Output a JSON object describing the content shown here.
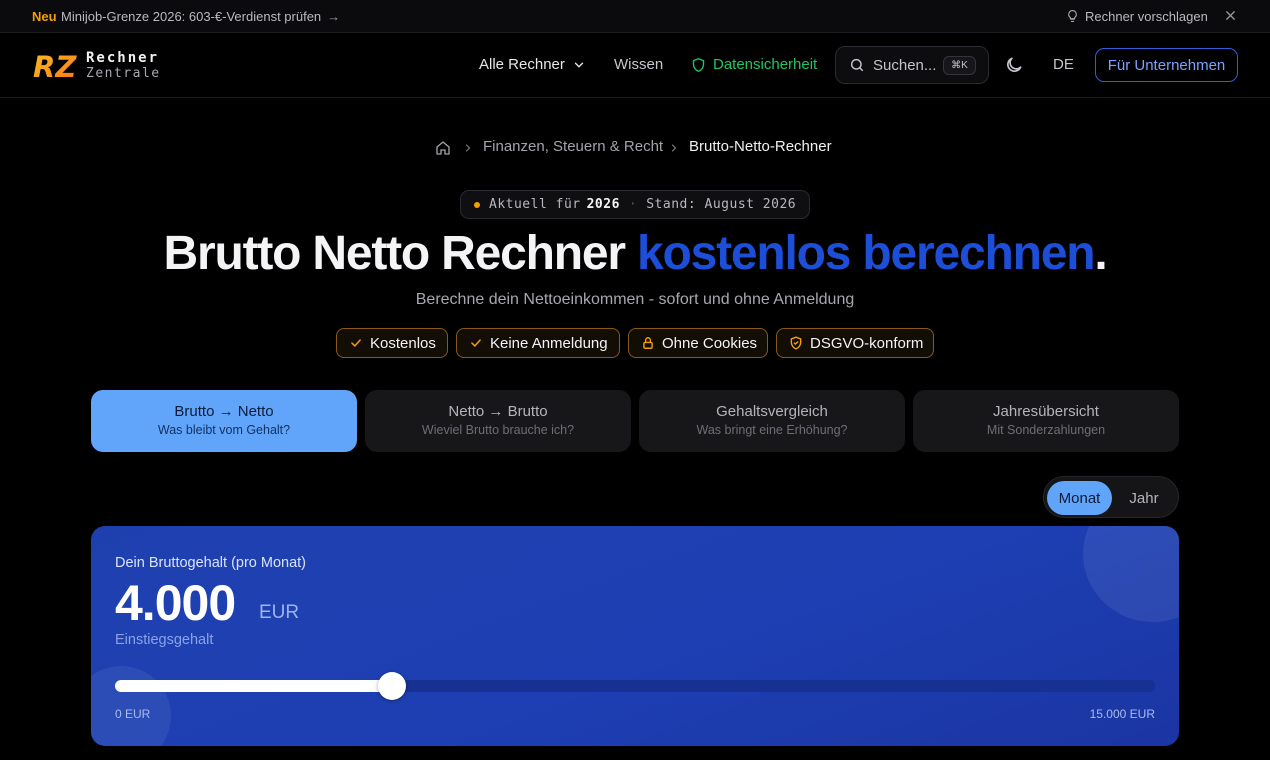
{
  "announcement": {
    "tag": "Neu",
    "message": "Minijob-Grenze 2026: 603-€-Verdienst prüfen",
    "arrow": "→",
    "suggest_label": "Rechner vorschlagen"
  },
  "header": {
    "logo_mark": "RZ",
    "logo_line1": "Rechner",
    "logo_line2": "Zentrale",
    "nav_all": "Alle Rechner",
    "nav_wissen": "Wissen",
    "nav_security": "Datensicherheit",
    "search_placeholder": "Suchen...",
    "search_shortcut": "⌘K",
    "language": "DE",
    "business_button": "Für Unternehmen"
  },
  "breadcrumb": {
    "category": "Finanzen, Steuern & Recht",
    "current": "Brutto-Netto-Rechner",
    "separator": "›"
  },
  "badge": {
    "prefix": "Aktuell für",
    "year": "2026",
    "divider": "·",
    "stand": "Stand: August 2026"
  },
  "hero": {
    "title_main": "Brutto Netto Rechner",
    "title_accent": "kostenlos berechnen",
    "title_end": ".",
    "subtitle": "Berechne dein Nettoeinkommen - sofort und ohne Anmeldung"
  },
  "features": [
    {
      "label": "Kostenlos",
      "icon": "check-icon"
    },
    {
      "label": "Keine Anmeldung",
      "icon": "check-icon"
    },
    {
      "label": "Ohne Cookies",
      "icon": "lock-icon"
    },
    {
      "label": "DSGVO-konform",
      "icon": "shield-icon"
    }
  ],
  "tabs": [
    {
      "title": "Brutto → Netto",
      "subtitle": "Was bleibt vom Gehalt?",
      "active": true
    },
    {
      "title": "Netto → Brutto",
      "subtitle": "Wieviel Brutto brauche ich?",
      "active": false
    },
    {
      "title": "Gehaltsvergleich",
      "subtitle": "Was bringt eine Erhöhung?",
      "active": false
    },
    {
      "title": "Jahresübersicht",
      "subtitle": "Mit Sonderzahlungen",
      "active": false
    }
  ],
  "period_toggle": {
    "monat": "Monat",
    "jahr": "Jahr",
    "selected": "Monat"
  },
  "salary": {
    "label": "Dein Bruttogehalt (pro Monat)",
    "amount": "4.000",
    "currency": "EUR",
    "hint": "Einstiegsgehalt",
    "slider_min_label": "0 EUR",
    "slider_max_label": "15.000 EUR",
    "slider_value": 4000,
    "slider_min": 0,
    "slider_max": 15000
  },
  "colors": {
    "accent_blue": "#1d4ed8",
    "active_tab": "#60a5fa",
    "security_green": "#22c55e",
    "neu_orange": "#f59e0b",
    "card_bg": "#1e40af"
  }
}
